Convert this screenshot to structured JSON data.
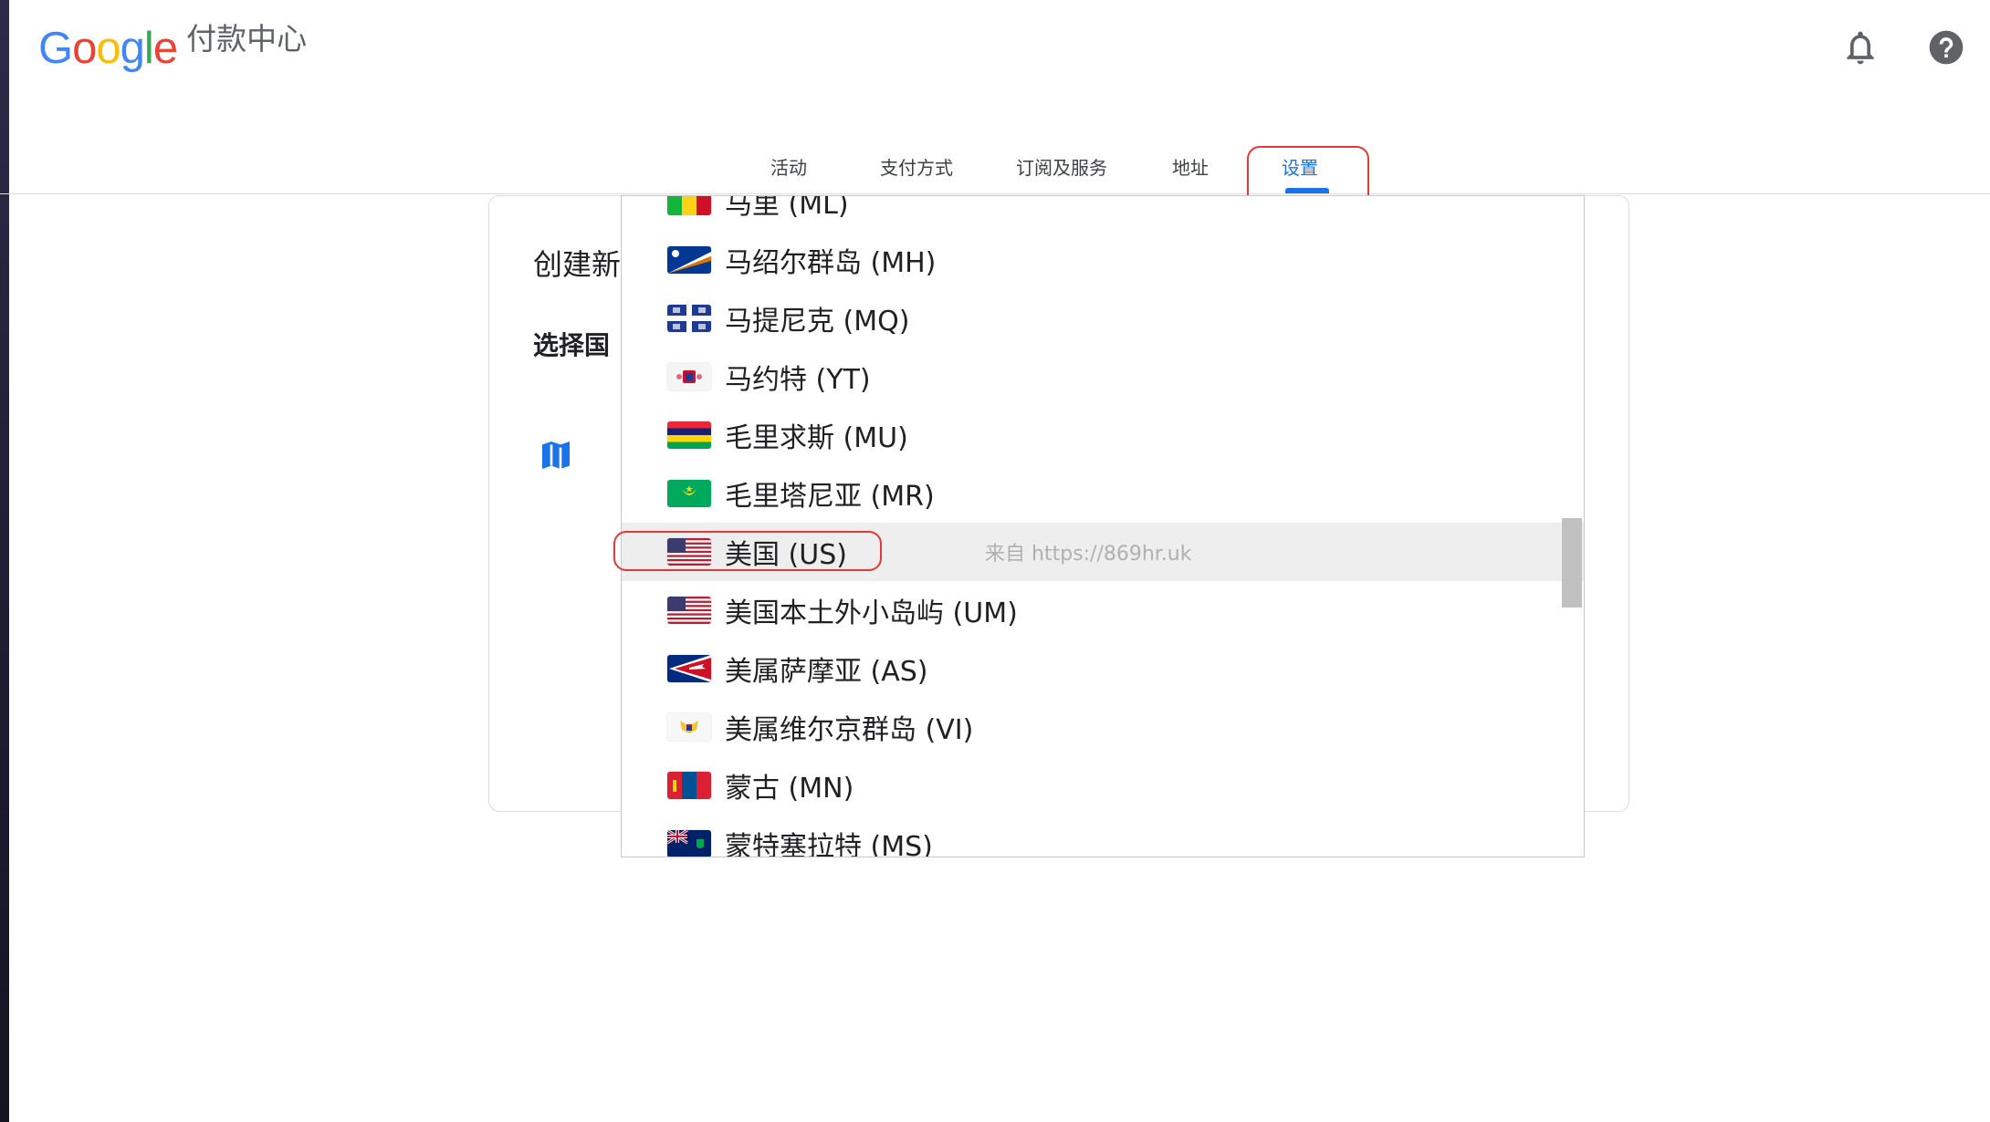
{
  "header": {
    "logo_text": "Google",
    "logo_letters": [
      {
        "ch": "G",
        "color": "#4285F4"
      },
      {
        "ch": "o",
        "color": "#EA4335"
      },
      {
        "ch": "o",
        "color": "#FBBC05"
      },
      {
        "ch": "g",
        "color": "#4285F4"
      },
      {
        "ch": "l",
        "color": "#34A853"
      },
      {
        "ch": "e",
        "color": "#EA4335"
      }
    ],
    "product_name": "付款中心",
    "icons": [
      "bell-icon",
      "help-icon"
    ]
  },
  "tabs": [
    {
      "label": "活动"
    },
    {
      "label": "支付方式"
    },
    {
      "label": "订阅及服务"
    },
    {
      "label": "地址"
    },
    {
      "label": "设置",
      "active": true
    }
  ],
  "card": {
    "title": "创建新",
    "label": "选择国"
  },
  "dropdown": {
    "items": [
      {
        "label": "马里 (ML)",
        "flag": "mali"
      },
      {
        "label": "马绍尔群岛 (MH)",
        "flag": "marshall"
      },
      {
        "label": "马提尼克 (MQ)",
        "flag": "martinique"
      },
      {
        "label": "马约特 (YT)",
        "flag": "mayotte"
      },
      {
        "label": "毛里求斯 (MU)",
        "flag": "mauritius"
      },
      {
        "label": "毛里塔尼亚 (MR)",
        "flag": "mauritania"
      },
      {
        "label": "美国 (US)",
        "flag": "us",
        "selected": true
      },
      {
        "label": "美国本土外小岛屿 (UM)",
        "flag": "us"
      },
      {
        "label": "美属萨摩亚 (AS)",
        "flag": "samoa"
      },
      {
        "label": "美属维尔京群岛 (VI)",
        "flag": "vi"
      },
      {
        "label": "蒙古 (MN)",
        "flag": "mongolia"
      },
      {
        "label": "蒙特塞拉特 (MS)",
        "flag": "montserrat"
      }
    ],
    "watermark": "来自 https://869hr.uk"
  },
  "colors": {
    "accent": "#1a73e8",
    "highlight": "#e53935",
    "selected_row": "#eeeeee"
  }
}
